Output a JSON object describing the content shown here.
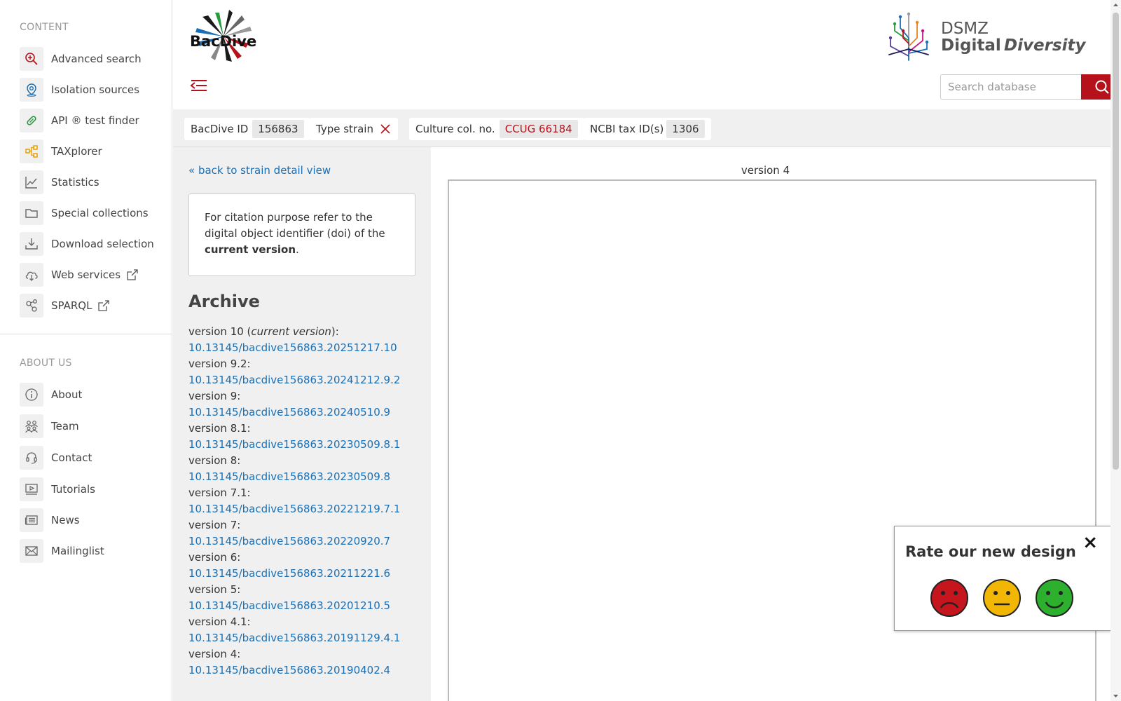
{
  "sidebar": {
    "content_title": "CONTENT",
    "content_items": [
      {
        "label": "Advanced search",
        "icon": "magnifier-plus-icon"
      },
      {
        "label": "Isolation sources",
        "icon": "location-pin-icon"
      },
      {
        "label": "API ® test finder",
        "icon": "test-tube-icon"
      },
      {
        "label": "TAXplorer",
        "icon": "hierarchy-icon"
      },
      {
        "label": "Statistics",
        "icon": "line-chart-icon"
      },
      {
        "label": "Special collections",
        "icon": "folder-icon"
      },
      {
        "label": "Download selection",
        "icon": "download-tray-icon"
      },
      {
        "label": "Web services",
        "icon": "cloud-download-icon",
        "external": true
      },
      {
        "label": "SPARQL",
        "icon": "share-nodes-icon",
        "external": true
      }
    ],
    "about_title": "ABOUT US",
    "about_items": [
      {
        "label": "About",
        "icon": "info-circle-icon"
      },
      {
        "label": "Team",
        "icon": "team-icon"
      },
      {
        "label": "Contact",
        "icon": "headset-icon"
      },
      {
        "label": "Tutorials",
        "icon": "video-player-icon"
      },
      {
        "label": "News",
        "icon": "newspaper-icon"
      },
      {
        "label": "Mailinglist",
        "icon": "envelope-icon"
      }
    ]
  },
  "header": {
    "logo_text": "BacDive",
    "dsmz_line1": "DSMZ",
    "dsmz_line2a": "Digital",
    "dsmz_line2b": "Diversity",
    "search_placeholder": "Search database"
  },
  "strain": {
    "id_label": "BacDive ID",
    "id_value": "156863",
    "type_strain_label": "Type strain",
    "culture_label": "Culture col. no.",
    "culture_value": "CCUG 66184",
    "ncbi_label": "NCBI tax ID(s)",
    "ncbi_value": "1306"
  },
  "left": {
    "back_link": "« back to strain detail view",
    "cite_text_1": "For citation purpose refer to the digital object identifier (doi) of the ",
    "cite_bold": "current version",
    "cite_text_2": ".",
    "archive_title": "Archive",
    "versions": [
      {
        "label": "version 10 (",
        "italic": "current version",
        "suffix": "):",
        "doi": "10.13145/bacdive156863.20251217.10"
      },
      {
        "label": "version 9.2:",
        "doi": "10.13145/bacdive156863.20241212.9.2"
      },
      {
        "label": "version 9:",
        "doi": "10.13145/bacdive156863.20240510.9"
      },
      {
        "label": "version 8.1:",
        "doi": "10.13145/bacdive156863.20230509.8.1"
      },
      {
        "label": "version 8:",
        "doi": "10.13145/bacdive156863.20230509.8"
      },
      {
        "label": "version 7.1:",
        "doi": "10.13145/bacdive156863.20221219.7.1"
      },
      {
        "label": "version 7:",
        "doi": "10.13145/bacdive156863.20220920.7"
      },
      {
        "label": "version 6:",
        "doi": "10.13145/bacdive156863.20211221.6"
      },
      {
        "label": "version 5:",
        "doi": "10.13145/bacdive156863.20201210.5"
      },
      {
        "label": "version 4.1:",
        "doi": "10.13145/bacdive156863.20191129.4.1"
      },
      {
        "label": "version 4:",
        "doi": "10.13145/bacdive156863.20190402.4"
      }
    ]
  },
  "right": {
    "version_label": "version 4"
  },
  "rating": {
    "title": "Rate our new design",
    "close": "×",
    "colors": {
      "bad": "#c4161c",
      "neutral": "#f2b705",
      "good": "#2db02d"
    }
  },
  "colors": {
    "accent": "#b5121b",
    "link": "#1a6fb5"
  }
}
